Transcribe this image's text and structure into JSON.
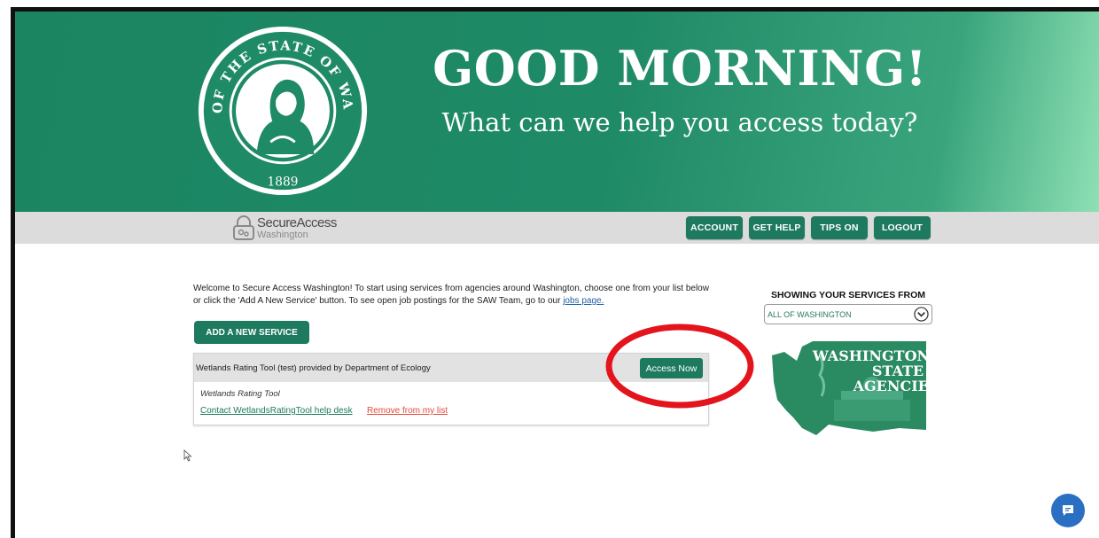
{
  "header": {
    "seal_text": "THE SEAL OF THE STATE OF WASHINGTON",
    "seal_year": "1889",
    "greeting": "GOOD MORNING!",
    "subtitle": "What can we help you access today?"
  },
  "brand": {
    "name": "SecureAccess",
    "sub": "Washington"
  },
  "nav": {
    "items": [
      {
        "label": "ACCOUNT"
      },
      {
        "label": "GET HELP"
      },
      {
        "label": "TIPS ON"
      },
      {
        "label": "LOGOUT"
      }
    ]
  },
  "main": {
    "welcome_text": "Welcome to Secure Access Washington! To start using services from agencies around Washington, choose one from your list below or click the 'Add A New Service' button. To see open job postings for the SAW Team, go to our ",
    "jobs_link": "jobs page.",
    "add_service_label": "ADD A NEW SERVICE",
    "service": {
      "title": "Wetlands Rating Tool (test) provided by Department of Ecology",
      "access_label": "Access Now",
      "description": "Wetlands Rating Tool",
      "help_link": "Contact WetlandsRatingTool help desk",
      "remove_link": "Remove from my list"
    }
  },
  "filter": {
    "heading": "SHOWING YOUR SERVICES FROM",
    "selected": "ALL OF WASHINGTON"
  },
  "agencies_map": {
    "line1": "WASHINGTON",
    "line2": "STATE",
    "line3": "AGENCIES"
  },
  "colors": {
    "brand_green": "#1d7a5e",
    "header_green": "#1f8a66",
    "highlight_red": "#e3141c",
    "remove_red": "#e24a3b",
    "chat_blue": "#2b6fc2"
  }
}
